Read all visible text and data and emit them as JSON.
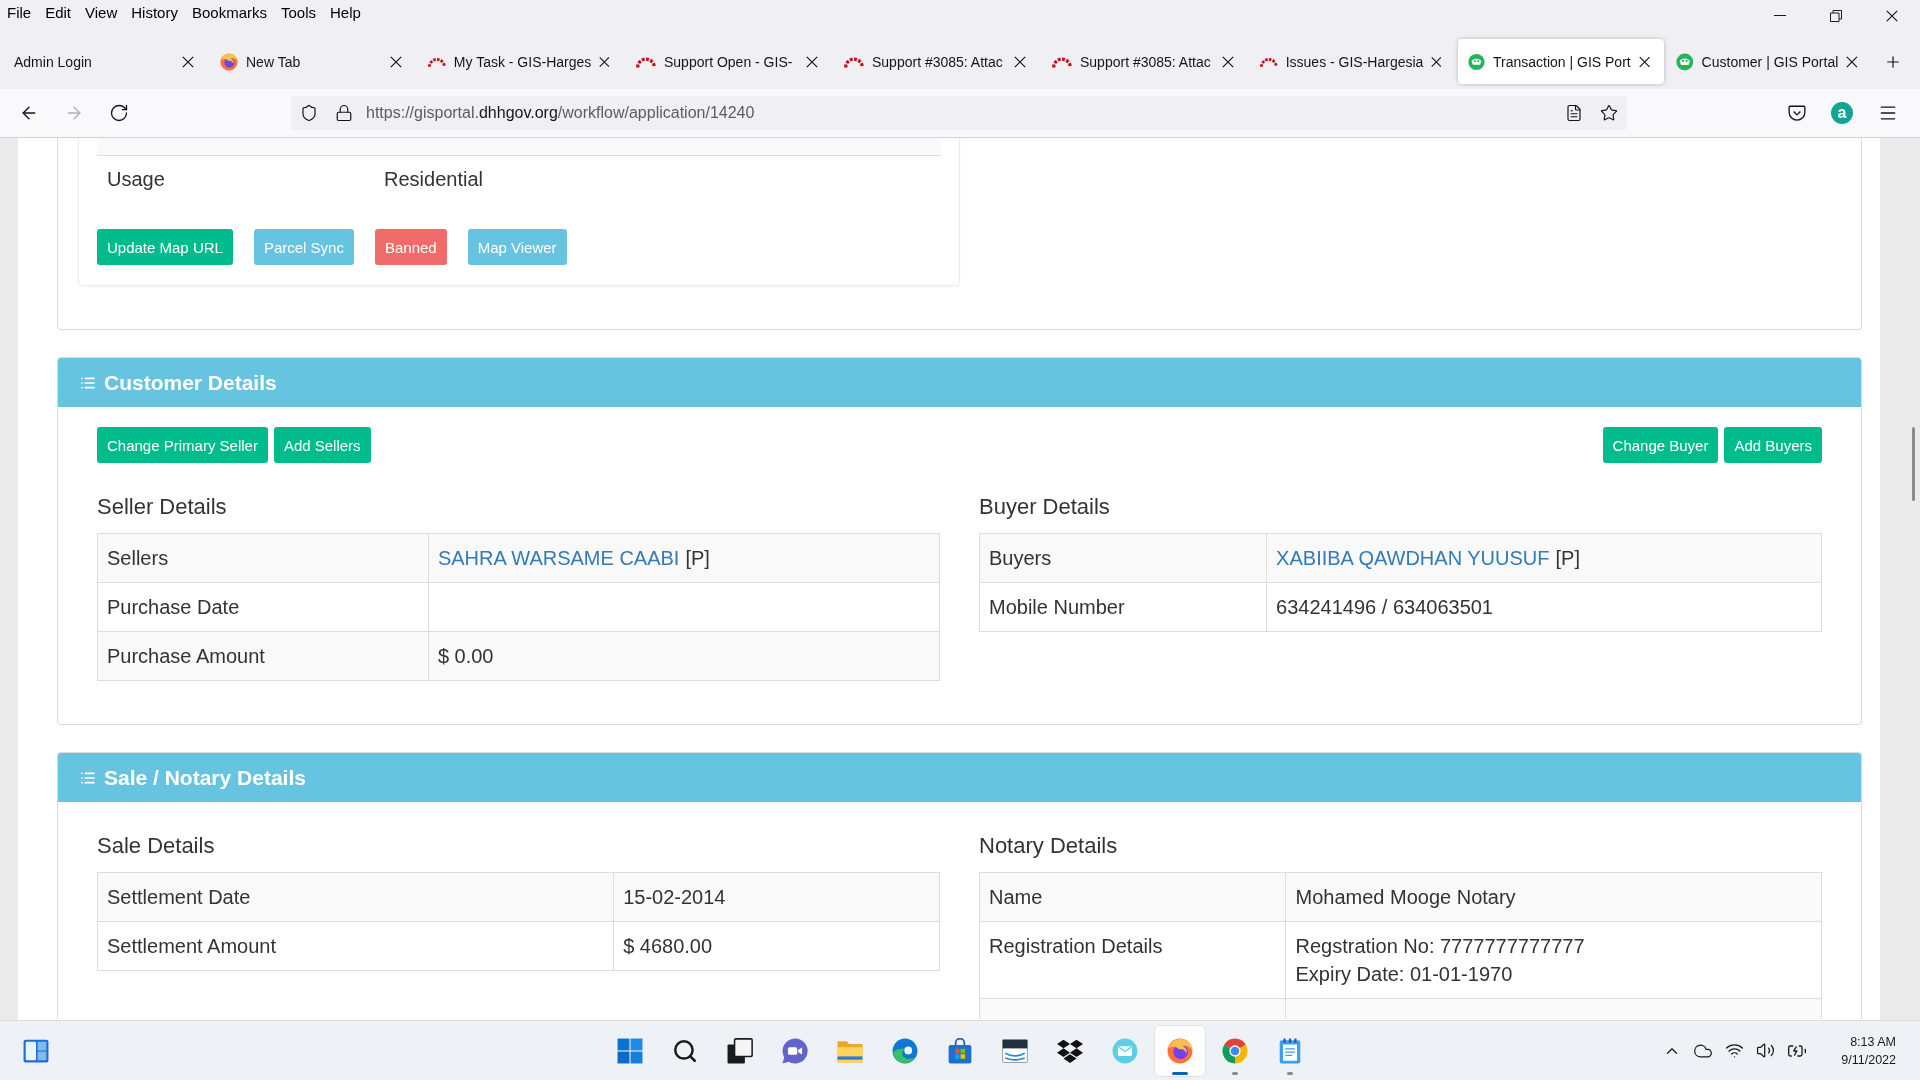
{
  "menu_bar": {
    "items": [
      "File",
      "Edit",
      "View",
      "History",
      "Bookmarks",
      "Tools",
      "Help"
    ]
  },
  "tabs": [
    {
      "title": "Admin Login",
      "kind": "plain",
      "selected": false
    },
    {
      "title": "New Tab",
      "kind": "firefox",
      "selected": false
    },
    {
      "title": "My Task - GIS-Harges",
      "kind": "arc",
      "selected": false
    },
    {
      "title": "Support Open - GIS-",
      "kind": "arc",
      "selected": false
    },
    {
      "title": "Support #3085: Attac",
      "kind": "arc",
      "selected": false
    },
    {
      "title": "Support #3085: Attac",
      "kind": "arc",
      "selected": false
    },
    {
      "title": "Issues - GIS-Hargesia",
      "kind": "arc",
      "selected": false
    },
    {
      "title": "Transaction | GIS Port",
      "kind": "gis",
      "selected": true
    },
    {
      "title": "Customer | GIS Portal",
      "kind": "gis",
      "selected": false
    }
  ],
  "address_bar": {
    "url_start": "https://gisportal.",
    "url_domain": "dhhgov.org",
    "url_end": "/workflow/application/14240",
    "back_disabled": false,
    "forward_disabled": true
  },
  "account": {
    "initial": "a"
  },
  "property_card": {
    "rows": [
      {
        "label": "Usage",
        "value": "Residential"
      }
    ],
    "buttons": [
      {
        "label": "Update Map URL",
        "kind": "success"
      },
      {
        "label": "Parcel Sync",
        "kind": "info"
      },
      {
        "label": "Banned",
        "kind": "danger"
      },
      {
        "label": "Map Viewer",
        "kind": "info"
      }
    ]
  },
  "panels": [
    {
      "title": "Customer Details",
      "toolbar": {
        "left": [
          {
            "label": "Change Primary Seller",
            "kind": "success"
          },
          {
            "label": "Add Sellers",
            "kind": "success"
          }
        ],
        "right": [
          {
            "label": "Change Buyer",
            "kind": "success"
          },
          {
            "label": "Add Buyers",
            "kind": "success"
          }
        ]
      },
      "sections": [
        {
          "heading": "Seller Details",
          "rows": [
            {
              "label": "Sellers",
              "link": "SAHRA WARSAME CAABI",
              "value": "[P]"
            },
            {
              "label": "Purchase Date"
            },
            {
              "label": "Purchase Amount",
              "value": "$ 0.00"
            }
          ]
        },
        {
          "heading": "Buyer Details",
          "rows": [
            {
              "label": "Buyers",
              "link": "XABIIBA QAWDHAN YUUSUF",
              "value": "[P]"
            },
            {
              "label": "Mobile Number",
              "value": "634241496 / 634063501"
            }
          ]
        }
      ]
    },
    {
      "title": "Sale / Notary Details",
      "sections": [
        {
          "heading": "Sale Details",
          "rows": [
            {
              "label": "Settlement Date",
              "value": "15-02-2014"
            },
            {
              "label": "Settlement Amount",
              "value": "$ 4680.00"
            }
          ]
        },
        {
          "heading": "Notary Details",
          "rows": [
            {
              "label": "Name",
              "value": "Mohamed Mooge Notary"
            },
            {
              "label": "Registration Details",
              "lines": [
                "Regstration No: 7777777777777",
                "Expiry Date: 01-01-1970"
              ]
            }
          ]
        }
      ]
    }
  ],
  "taskbar": {
    "apps": [
      {
        "kind": "start",
        "running": false,
        "selected": false
      },
      {
        "kind": "search",
        "running": false,
        "selected": false
      },
      {
        "kind": "taskview",
        "running": false,
        "selected": false
      },
      {
        "kind": "chat",
        "running": false,
        "selected": false
      },
      {
        "kind": "explorer",
        "running": false,
        "selected": false
      },
      {
        "kind": "edge",
        "running": false,
        "selected": false
      },
      {
        "kind": "store",
        "running": false,
        "selected": false
      },
      {
        "kind": "package",
        "running": false,
        "selected": false
      },
      {
        "kind": "dropbox",
        "running": false,
        "selected": false
      },
      {
        "kind": "mail",
        "running": false,
        "selected": false
      },
      {
        "kind": "firefox",
        "running": true,
        "selected": true
      },
      {
        "kind": "chrome",
        "running": true,
        "selected": false
      },
      {
        "kind": "notepad",
        "running": true,
        "selected": false
      }
    ],
    "clock": {
      "time": "8:13 AM",
      "date": "9/11/2022"
    }
  }
}
